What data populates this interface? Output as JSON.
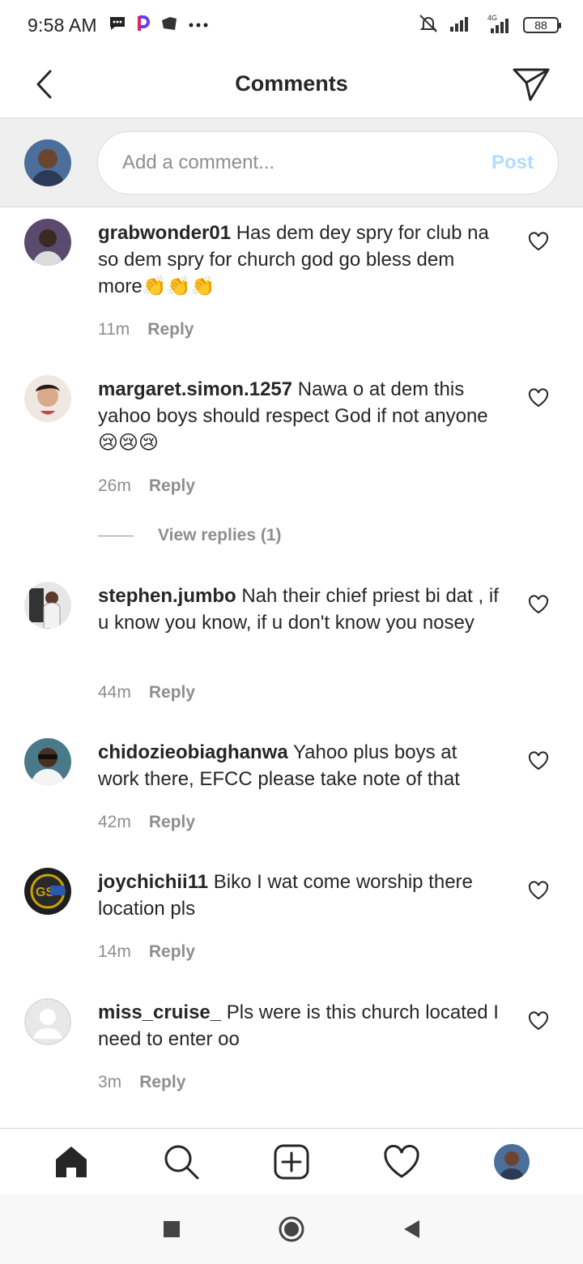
{
  "status_bar": {
    "time": "9:58 AM",
    "battery": "88",
    "network": "4G"
  },
  "header": {
    "title": "Comments"
  },
  "composer": {
    "placeholder": "Add a comment...",
    "post_label": "Post"
  },
  "comments": [
    {
      "username": "grabwonder01",
      "text": "Has dem dey spry for club na so dem spry for church god go bless dem more👏👏👏",
      "time": "11m",
      "reply_label": "Reply",
      "avatar_color": "#5a4a6e"
    },
    {
      "username": "margaret.simon.1257",
      "text": "Nawa o at dem this yahoo boys should respect God if not anyone 😢😢😢",
      "time": "26m",
      "reply_label": "Reply",
      "view_replies": "View replies (1)",
      "avatar_color": "#b04a4a"
    },
    {
      "username": "stephen.jumbo",
      "text": "Nah their chief priest bi dat , if u know you know, if u don't know you nosey",
      "time": "44m",
      "reply_label": "Reply",
      "avatar_color": "#9a9a9a"
    },
    {
      "username": "chidozieobiaghanwa",
      "text": "Yahoo plus boys at work there, EFCC please take note of that",
      "time": "42m",
      "reply_label": "Reply",
      "avatar_color": "#4a7a8a"
    },
    {
      "username": "joychichii11",
      "text": "Biko I wat come worship there location pls",
      "time": "14m",
      "reply_label": "Reply",
      "avatar_color": "#1e1e1e"
    },
    {
      "username": "miss_cruise_",
      "text": "Pls were is this church located I need to enter oo",
      "time": "3m",
      "reply_label": "Reply",
      "avatar_color": "#dcdcdc"
    }
  ],
  "colors": {
    "accent_post": "#b3dbff",
    "secondary_text": "#8e8e8e",
    "primary_text": "#262626"
  }
}
